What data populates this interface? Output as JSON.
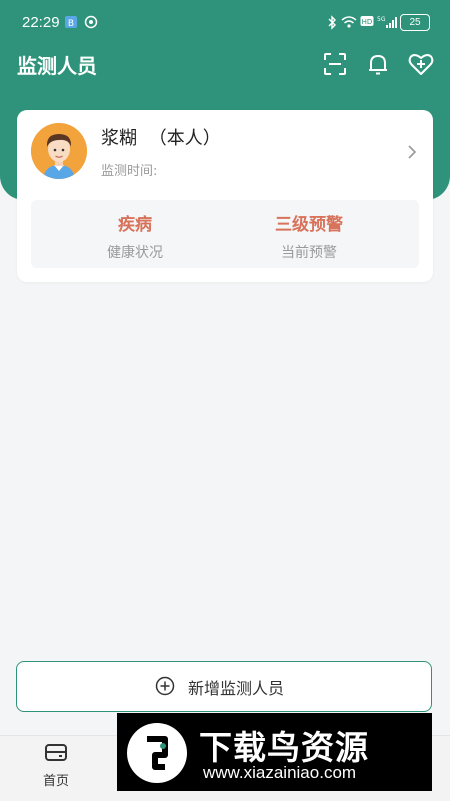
{
  "status_bar": {
    "time": "22:29",
    "battery": "25"
  },
  "header": {
    "title": "监测人员"
  },
  "person": {
    "name": "浆糊",
    "tag": "（本人）",
    "monitor_time_label": "监测时间:",
    "health_value": "疾病",
    "health_label": "健康状况",
    "warning_value": "三级预警",
    "warning_label": "当前预警"
  },
  "add_button": {
    "label": "新增监测人员"
  },
  "tabbar": {
    "home_label": "首页"
  },
  "watermark": {
    "title": "下载鸟资源",
    "url": "www.xiazainiao.com"
  },
  "colors": {
    "accent": "#2e937a",
    "warning": "#d9725a"
  },
  "icons": [
    "scan-icon",
    "bell-icon",
    "heart-plus-icon",
    "chevron-right-icon",
    "plus-circle-icon",
    "home-icon"
  ]
}
